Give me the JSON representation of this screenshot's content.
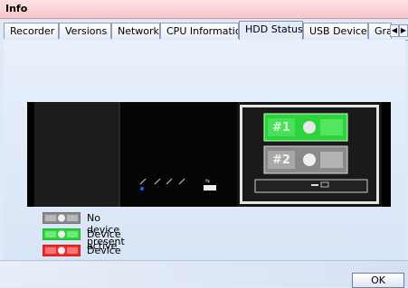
{
  "window": {
    "title": "Info"
  },
  "tabs": [
    {
      "label": "Recorder"
    },
    {
      "label": "Versions"
    },
    {
      "label": "Network"
    },
    {
      "label": "CPU Information"
    },
    {
      "label": "HDD Status",
      "active": true
    },
    {
      "label": "USB Devices"
    },
    {
      "label": "Gra"
    }
  ],
  "hdd_bays": [
    {
      "label": "#1",
      "status": "active"
    },
    {
      "label": "#2",
      "status": "none"
    }
  ],
  "legend": [
    {
      "label": "No device present",
      "color": "#8a8a8a"
    },
    {
      "label": "Device active",
      "color": "#2bd43a"
    },
    {
      "label": "Device error",
      "color": "#ef2b2b"
    }
  ],
  "buttons": {
    "ok": "OK"
  },
  "colors": {
    "active": "#2bd43a",
    "none": "#8a8a8a",
    "error": "#ef2b2b"
  }
}
